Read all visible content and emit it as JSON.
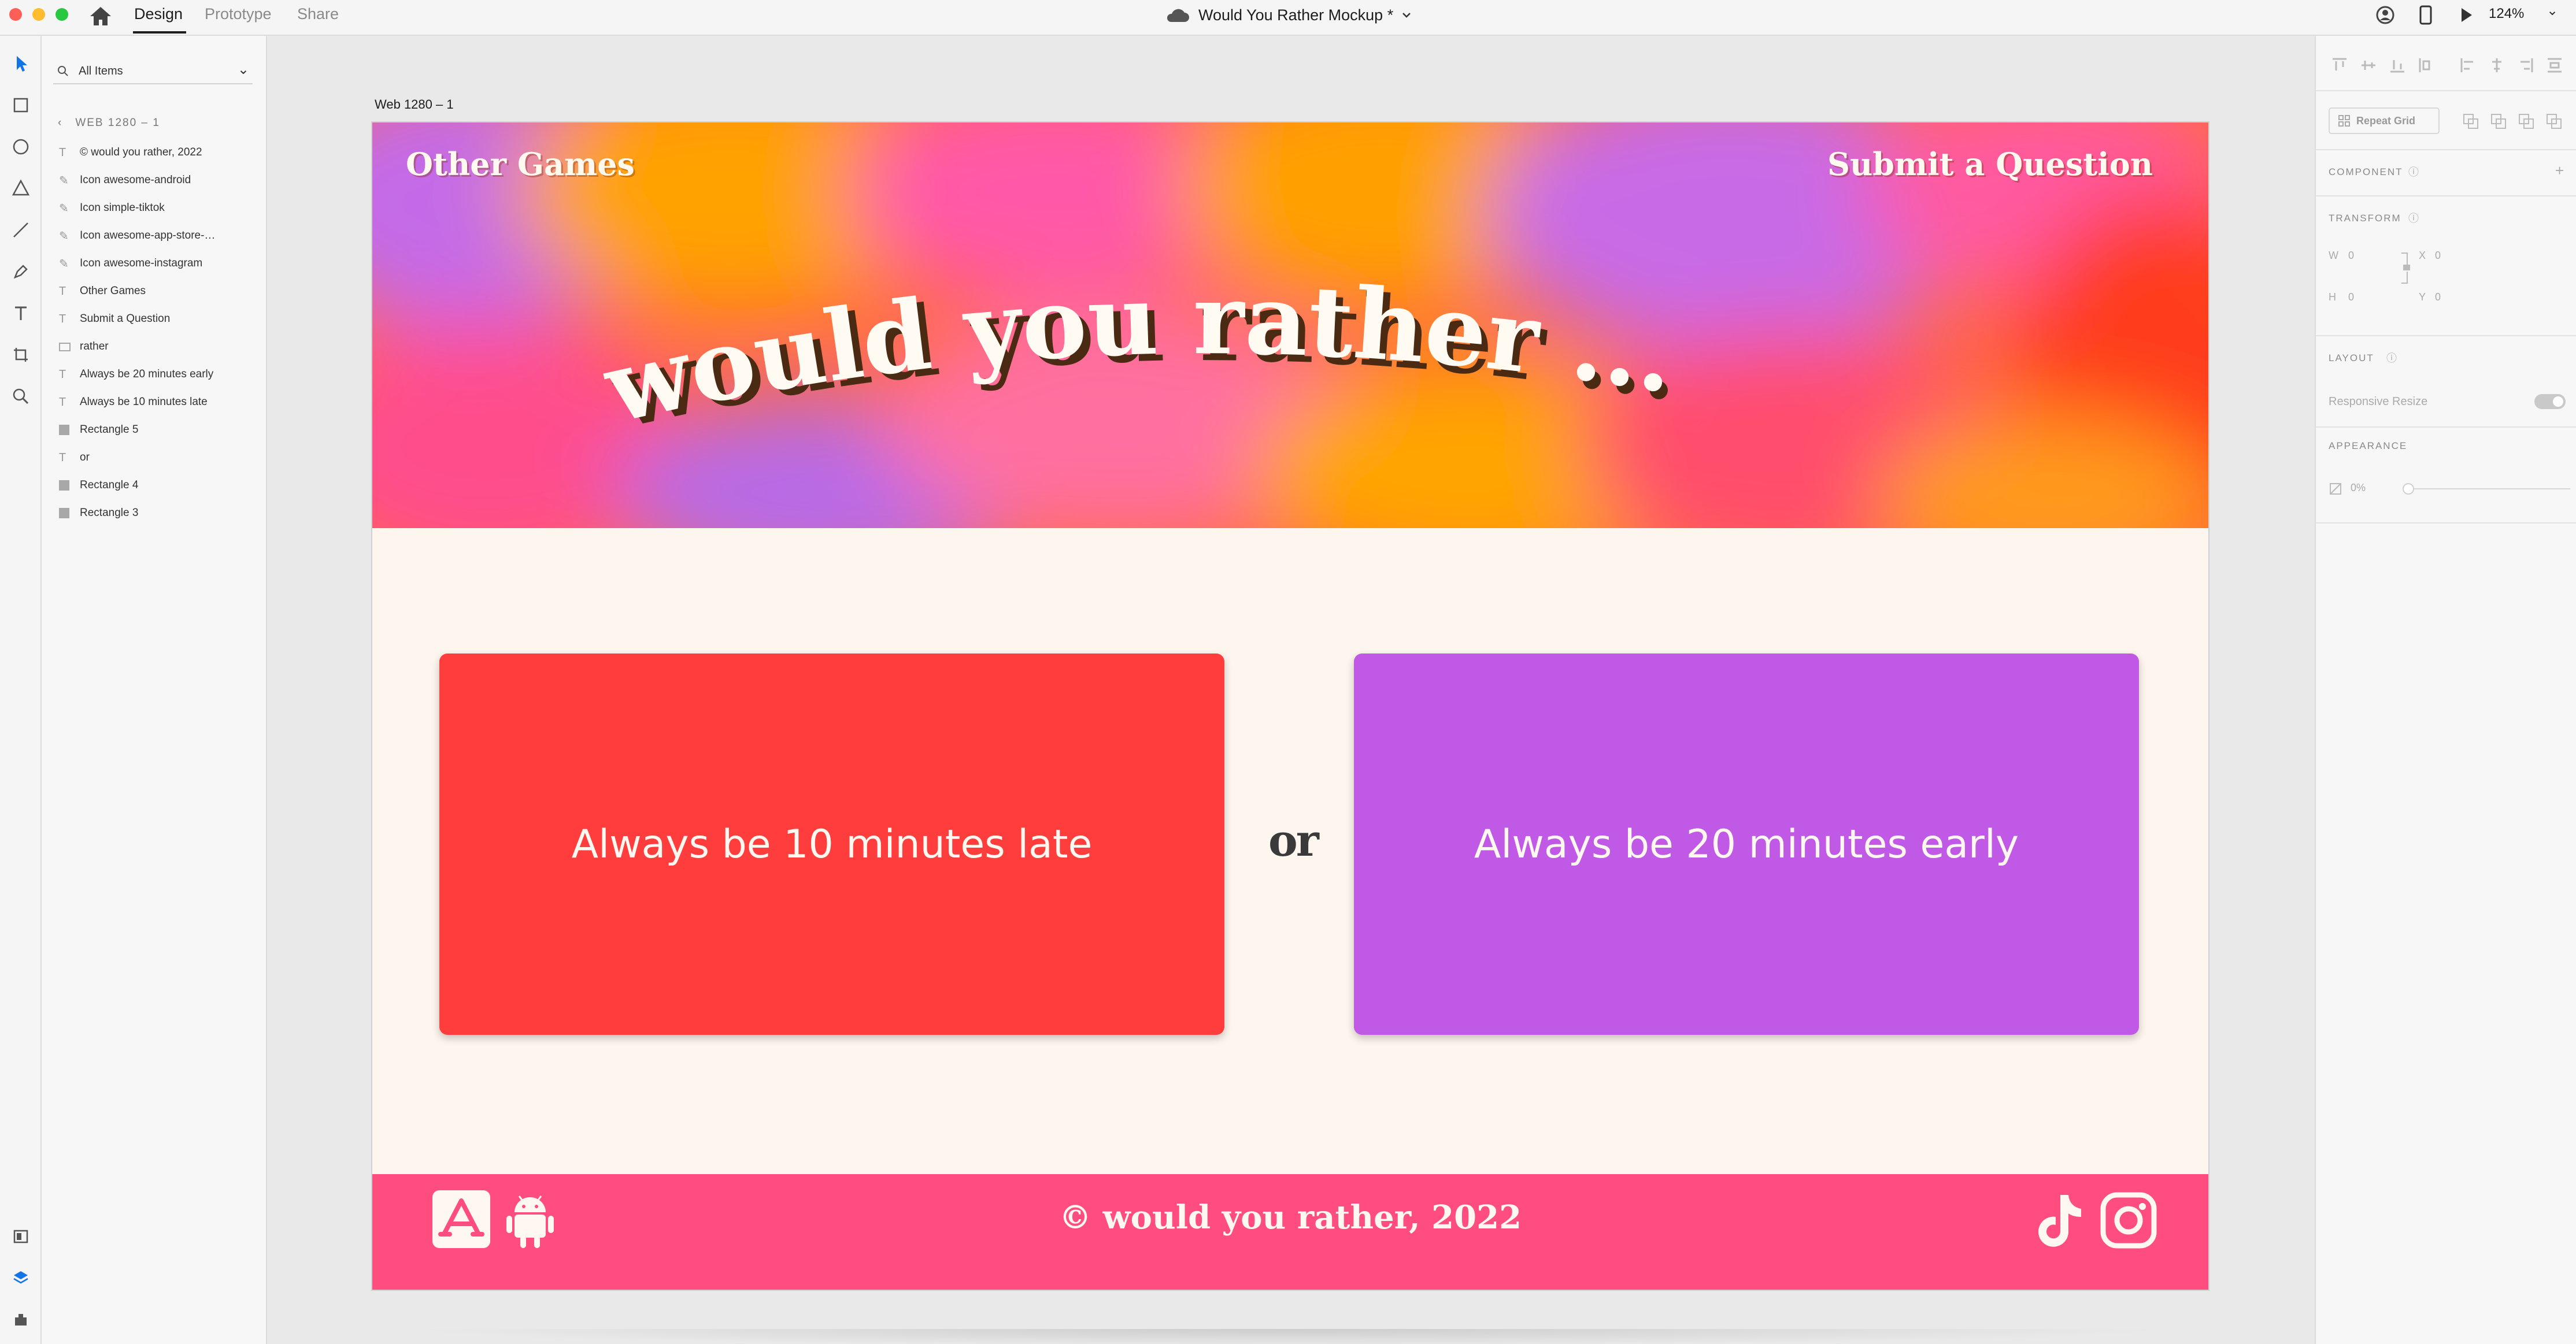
{
  "topbar": {
    "tabs": [
      {
        "label": "Design",
        "active": true
      },
      {
        "label": "Prototype",
        "active": false
      },
      {
        "label": "Share",
        "active": false
      }
    ],
    "document_title": "Would You Rather Mockup *",
    "zoom": "124%"
  },
  "layers": {
    "search_label": "All Items",
    "breadcrumb": "WEB 1280 – 1",
    "items": [
      {
        "label": "© would you rather, 2022",
        "icon": "text-icon"
      },
      {
        "label": "Icon awesome-android",
        "icon": "path-icon"
      },
      {
        "label": "Icon simple-tiktok",
        "icon": "path-icon"
      },
      {
        "label": "Icon awesome-app-store-…",
        "icon": "path-icon"
      },
      {
        "label": "Icon awesome-instagram",
        "icon": "path-icon"
      },
      {
        "label": "Other Games",
        "icon": "text-icon"
      },
      {
        "label": "Submit a Question",
        "icon": "text-icon"
      },
      {
        "label": "rather",
        "icon": "image-icon"
      },
      {
        "label": "Always be 20 minutes early",
        "icon": "text-icon"
      },
      {
        "label": "Always be 10 minutes late",
        "icon": "text-icon"
      },
      {
        "label": "Rectangle 5",
        "icon": "rectangle-icon"
      },
      {
        "label": "or",
        "icon": "text-icon"
      },
      {
        "label": "Rectangle 4",
        "icon": "rectangle-icon"
      },
      {
        "label": "Rectangle 3",
        "icon": "rectangle-icon"
      }
    ]
  },
  "canvas": {
    "artboard_label": "Web 1280 – 1",
    "hero": {
      "left_link": "Other Games",
      "right_link": "Submit a Question",
      "headline": "would you rather ..."
    },
    "option_left": {
      "text": "Always be 10 minutes late",
      "color": "#ff3d3d"
    },
    "option_right": {
      "text": "Always be 20 minutes early",
      "color": "#c05ae6"
    },
    "or_label": "or",
    "footer": {
      "text": "© would you rather, 2022",
      "color": "#ff4d80",
      "left_icons": [
        "app-store-icon",
        "android-icon"
      ],
      "right_icons": [
        "tiktok-icon",
        "instagram-icon"
      ]
    }
  },
  "properties": {
    "repeat_grid_label": "Repeat Grid",
    "component_heading": "COMPONENT",
    "transform_heading": "TRANSFORM",
    "w_label": "W",
    "w_value": "0",
    "x_label": "X",
    "x_value": "0",
    "h_label": "H",
    "h_value": "0",
    "y_label": "Y",
    "y_value": "0",
    "layout_heading": "LAYOUT",
    "responsive_resize_label": "Responsive Resize",
    "appearance_heading": "APPEARANCE",
    "opacity_value": "0%"
  },
  "colors": {
    "accent_blue": "#1473e6",
    "hero_orange": "#ff9a1f",
    "hero_pink": "#ff4fa0",
    "hero_purple": "#c06af0"
  }
}
